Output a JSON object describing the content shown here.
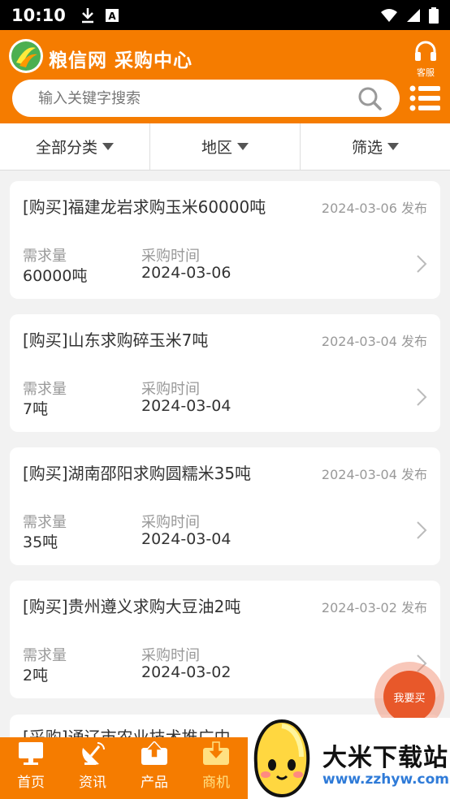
{
  "status_bar": {
    "time": "10:10"
  },
  "header": {
    "title": "粮信网 采购中心",
    "service_label": "客服",
    "search_placeholder": "输入关键字搜索"
  },
  "filters": [
    {
      "label": "全部分类"
    },
    {
      "label": "地区"
    },
    {
      "label": "筛选"
    }
  ],
  "field_labels": {
    "quantity": "需求量",
    "purchase_time": "采购时间"
  },
  "listings": [
    {
      "title": "[购买]福建龙岩求购玉米60000吨",
      "posted": "2024-03-06 发布",
      "quantity": "60000吨",
      "purchase_time": "2024-03-06"
    },
    {
      "title": "[购买]山东求购碎玉米7吨",
      "posted": "2024-03-04 发布",
      "quantity": "7吨",
      "purchase_time": "2024-03-04"
    },
    {
      "title": "[购买]湖南邵阳求购圆糯米35吨",
      "posted": "2024-03-04 发布",
      "quantity": "35吨",
      "purchase_time": "2024-03-04"
    },
    {
      "title": "[购买]贵州遵义求购大豆油2吨",
      "posted": "2024-03-02 发布",
      "quantity": "2吨",
      "purchase_time": "2024-03-02"
    }
  ],
  "partial_listing": {
    "title": "[采购]通辽市农业技术推广中"
  },
  "fab_label": "我要买",
  "bottom_nav": [
    {
      "label": "首页",
      "icon": "monitor-icon"
    },
    {
      "label": "资讯",
      "icon": "satellite-dish-icon"
    },
    {
      "label": "产品",
      "icon": "upload-box-icon"
    },
    {
      "label": "商机",
      "icon": "download-box-icon",
      "active": true
    }
  ],
  "watermark": {
    "brand": "大米下载站",
    "url": "www.zzhyw.com"
  },
  "colors": {
    "primary": "#f57c00",
    "fab": "#e8582a",
    "active_nav": "#ffe082",
    "watermark_url": "#2f7bd8"
  }
}
